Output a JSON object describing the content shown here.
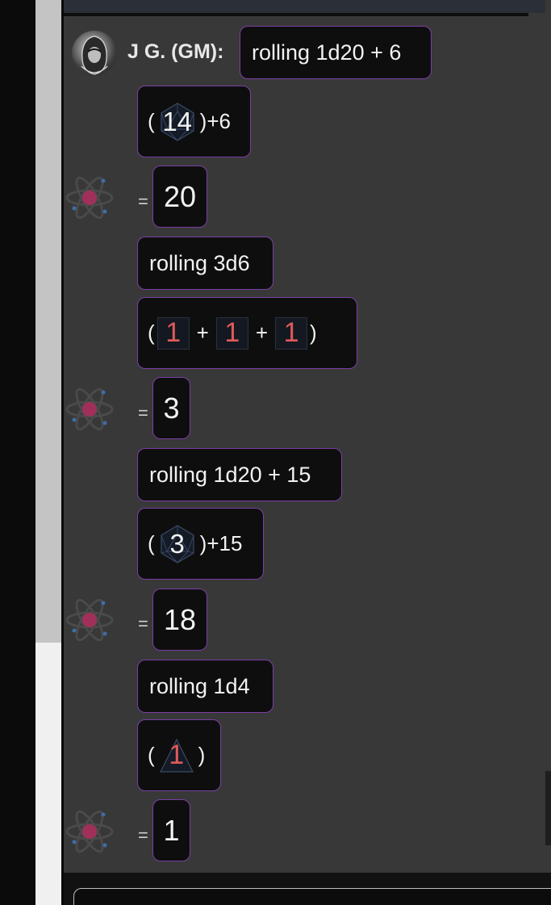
{
  "speaker": {
    "name": "J G. (GM):"
  },
  "messages": [
    {
      "text": "rolling 1d20 + 6",
      "open": "(",
      "dice": [
        {
          "value": "14",
          "kind": "d20",
          "crit_low": false
        }
      ],
      "close": ")",
      "modifier": "+6",
      "equals": "=",
      "result": "20"
    },
    {
      "text": "rolling 3d6",
      "open": "(",
      "dice": [
        {
          "value": "1",
          "kind": "d6",
          "crit_low": true
        },
        {
          "value": "1",
          "kind": "d6",
          "crit_low": true
        },
        {
          "value": "1",
          "kind": "d6",
          "crit_low": true
        }
      ],
      "plus": "+",
      "close": ")",
      "modifier": "",
      "equals": "=",
      "result": "3"
    },
    {
      "text": "rolling 1d20 + 15",
      "open": "(",
      "dice": [
        {
          "value": "3",
          "kind": "d20",
          "crit_low": false
        }
      ],
      "close": ")",
      "modifier": "+15",
      "equals": "=",
      "result": "18"
    },
    {
      "text": "rolling 1d4",
      "open": "(",
      "dice": [
        {
          "value": "1",
          "kind": "d4",
          "crit_low": true
        }
      ],
      "close": ")",
      "modifier": "",
      "equals": "=",
      "result": "1"
    }
  ],
  "icons": {
    "gm_avatar": "hooded-figure-avatar",
    "roll_result": "atom-icon"
  },
  "colors": {
    "bubble_border": "#7b3ea6",
    "bubble_bg": "#0e0e0e",
    "panel_bg": "#383838",
    "crit_low": "#e05a5a",
    "atom_core": "#a0305a"
  }
}
